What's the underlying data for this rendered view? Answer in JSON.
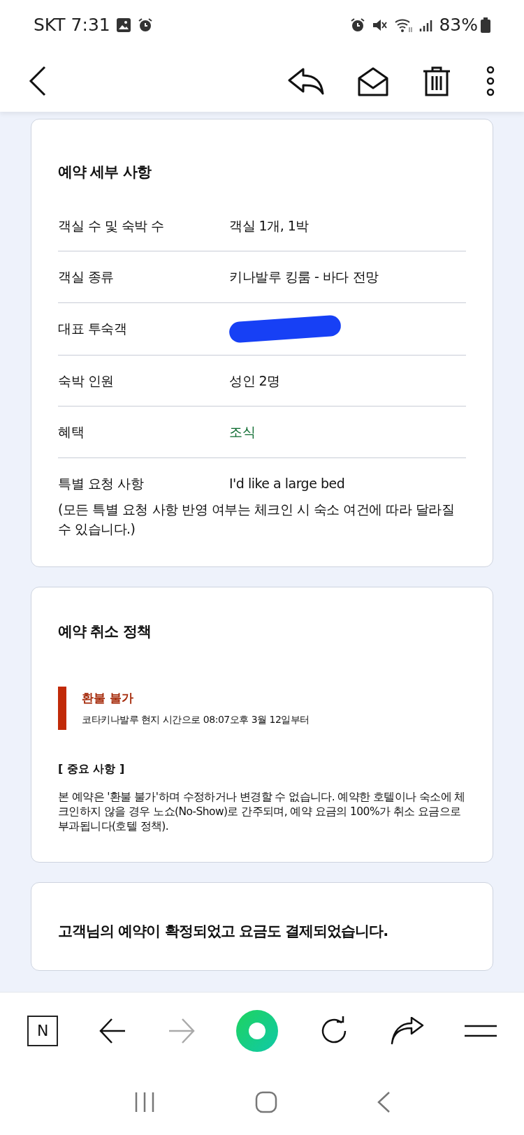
{
  "status_bar": {
    "carrier": "SKT",
    "time": "7:31",
    "battery": "83%"
  },
  "details": {
    "title": "예약 세부 사항",
    "rows": [
      {
        "label": "객실 수 및 숙박 수",
        "value": "객실 1개, 1박",
        "kind": "text"
      },
      {
        "label": "객실 종류",
        "value": "키나발루 킹룸 - 바다 전망",
        "kind": "text"
      },
      {
        "label": "대표 투숙객",
        "kind": "redacted"
      },
      {
        "label": "숙박 인원",
        "value": "성인 2명",
        "kind": "text"
      },
      {
        "label": "혜택",
        "value": "조식",
        "kind": "highlight"
      },
      {
        "label": "특별 요청 사항",
        "value": "I'd like a large bed",
        "kind": "text"
      }
    ],
    "note": "(모든 특별 요청 사항 반영 여부는 체크인 시 숙소 여건에 따라 달라질 수 있습니다.)"
  },
  "cancellation": {
    "title": "예약 취소 정책",
    "policy": {
      "name": "환불 불가",
      "detail": "코타키나발루 현지 시간으로 08:07오후 3월 12일부터"
    },
    "important_heading": "[ 중요 사항 ]",
    "important_text": "본 예약은 '환불 불가'하며 수정하거나 변경할 수 없습니다. 예약한 호텔이나 숙소에 체크인하지 않을 경우 노쇼(No-Show)로 간주되며, 예약 요금의 100%가 취소 요금으로 부과됩니다(호텔 정책)."
  },
  "confirmation": {
    "title": "고객님의 예약이 확정되었고 요금도 결제되었습니다."
  },
  "browser_toolbar": {
    "home_letter": "N",
    "back_disabled": false,
    "forward_disabled": true
  }
}
